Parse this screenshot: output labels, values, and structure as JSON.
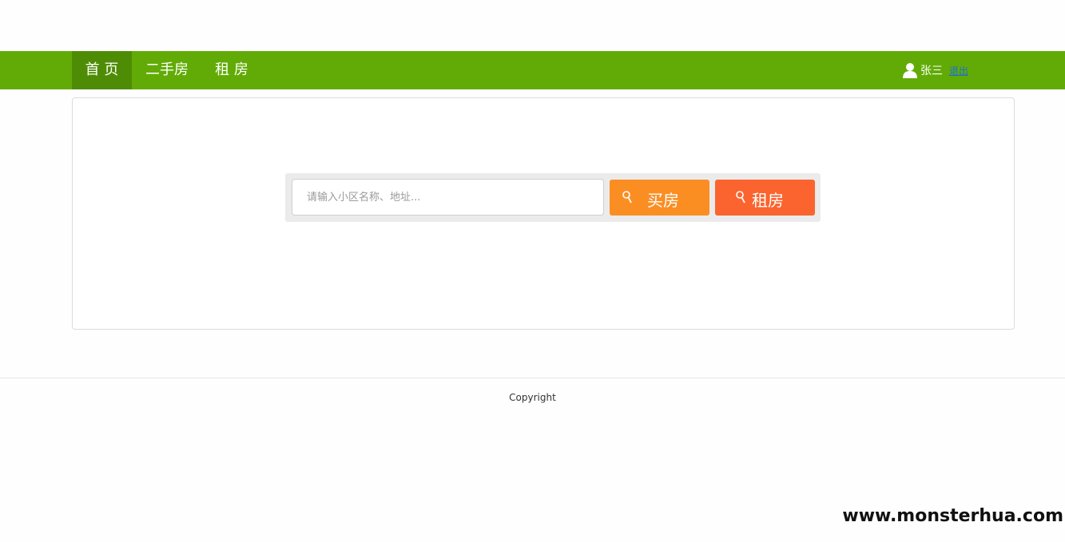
{
  "nav": {
    "items": [
      {
        "label": "首 页",
        "active": true
      },
      {
        "label": "二手房",
        "active": false
      },
      {
        "label": "租 房",
        "active": false
      }
    ],
    "active_color": "#4e8c05",
    "bar_color": "#62ab06"
  },
  "user": {
    "icon": "user-icon",
    "name": "张三",
    "logout_label": "退出"
  },
  "search": {
    "placeholder": "请输入小区名称、地址...",
    "value": "",
    "buy_label": "买房",
    "rent_label": "租房",
    "buy_color": "#fb8e23",
    "rent_color": "#fb642f",
    "button_icon": "search-icon"
  },
  "footer": {
    "copyright": "Copyright"
  },
  "watermark": "www.monsterhua.com"
}
